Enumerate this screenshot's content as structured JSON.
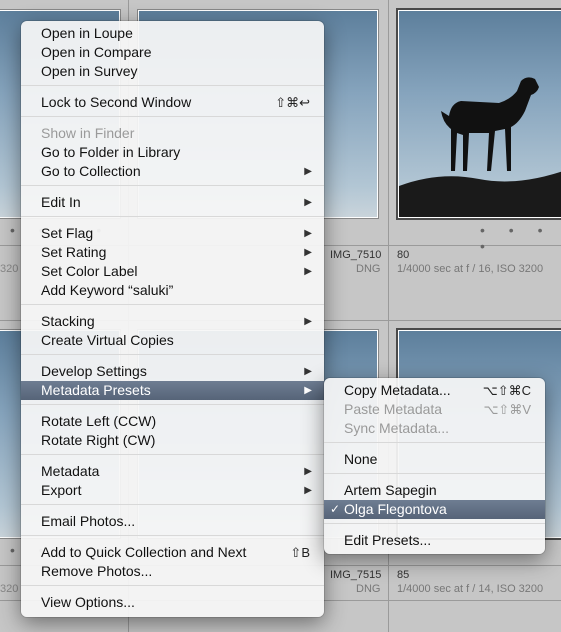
{
  "grid": {
    "row1": {
      "filename": "IMG_7510",
      "filetype": "DNG",
      "index": "80",
      "exif": "1/4000 sec at f / 16, ISO 3200",
      "left_text": "320"
    },
    "row2": {
      "filename": "IMG_7515",
      "filetype": "DNG",
      "index": "85",
      "exif": "1/4000 sec at f / 14, ISO 3200",
      "left_text": "320"
    },
    "dots": "• • • •"
  },
  "menu": {
    "open_loupe": "Open in Loupe",
    "open_compare": "Open in Compare",
    "open_survey": "Open in Survey",
    "lock_second_window": "Lock to Second Window",
    "lock_shortcut": "⇧⌘↩",
    "show_in_finder": "Show in Finder",
    "go_to_folder": "Go to Folder in Library",
    "go_to_collection": "Go to Collection",
    "edit_in": "Edit In",
    "set_flag": "Set Flag",
    "set_rating": "Set Rating",
    "set_color_label": "Set Color Label",
    "add_keyword": "Add Keyword “saluki”",
    "stacking": "Stacking",
    "create_virtual_copies": "Create Virtual Copies",
    "develop_settings": "Develop Settings",
    "metadata_presets": "Metadata Presets",
    "rotate_left": "Rotate Left (CCW)",
    "rotate_right": "Rotate Right (CW)",
    "metadata": "Metadata",
    "export": "Export",
    "email_photos": "Email Photos...",
    "add_quick_collection": "Add to Quick Collection and Next",
    "add_quick_shortcut": "⇧B",
    "remove_photos": "Remove Photos...",
    "view_options": "View Options..."
  },
  "submenu": {
    "copy_metadata": "Copy Metadata...",
    "copy_shortcut": "⌥⇧⌘C",
    "paste_metadata": "Paste Metadata",
    "paste_shortcut": "⌥⇧⌘V",
    "sync_metadata": "Sync Metadata...",
    "none": "None",
    "artem_sapegin": "Artem Sapegin",
    "olga_flegontova": "Olga Flegontova",
    "edit_presets": "Edit Presets..."
  },
  "icons": {
    "submenu_arrow": "▶",
    "checkmark": "✓"
  },
  "colors": {
    "highlight": "#5f6d82",
    "disabled_text": "#9a9a9a"
  }
}
